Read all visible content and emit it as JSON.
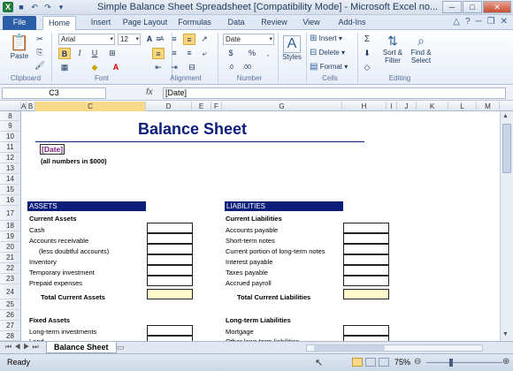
{
  "titlebar": {
    "title": "Simple Balance Sheet Spreadsheet  [Compatibility Mode]  -  Microsoft Excel no...",
    "qat_icons": [
      "excel-logo-icon",
      "save-icon",
      "undo-icon",
      "redo-icon",
      "customize-qat-icon"
    ]
  },
  "tabs": [
    "File",
    "Home",
    "Insert",
    "Page Layout",
    "Formulas",
    "Data",
    "Review",
    "View",
    "Add-Ins"
  ],
  "ribbon": {
    "clipboard": {
      "paste": "Paste",
      "label": "Clipboard"
    },
    "font": {
      "name": "Arial",
      "size": "12",
      "bold": "B",
      "italic": "I",
      "underline": "U",
      "grow": "A",
      "shrink": "A",
      "label": "Font"
    },
    "alignment": {
      "label": "Alignment"
    },
    "number": {
      "format": "Date",
      "currency": "$",
      "percent": "%",
      "comma": ",",
      "inc": ".0",
      "dec": ".00",
      "label": "Number"
    },
    "styles": {
      "styles": "Styles"
    },
    "cells": {
      "insert": "Insert",
      "delete": "Delete",
      "format": "Format",
      "label": "Cells"
    },
    "editing": {
      "sum": "Σ",
      "sort": "Sort &",
      "sort2": "Filter",
      "find": "Find &",
      "find2": "Select",
      "label": "Editing"
    }
  },
  "formula_bar": {
    "namebox": "C3",
    "fx": "fx",
    "content": "[Date]"
  },
  "columns": [
    "A",
    "B",
    "C",
    "D",
    "E",
    "F",
    "G",
    "H",
    "I",
    "J",
    "K",
    "L",
    "M"
  ],
  "rows": [
    "8",
    "9",
    "10",
    "11",
    "12",
    "13",
    "14",
    "15",
    "16",
    "17",
    "18",
    "19",
    "20",
    "21",
    "22",
    "23",
    "24",
    "25",
    "26",
    "27",
    "28"
  ],
  "sheet": {
    "title": "Balance Sheet",
    "date": "[Date]",
    "note": "(all numbers in $000)",
    "assets": {
      "header": "ASSETS",
      "current": "Current Assets",
      "items": [
        "Cash",
        "Accounts receivable",
        "(less doubtful accounts)",
        "Inventory",
        "Temporary investment",
        "Prepaid expenses"
      ],
      "total": "Total Current Assets",
      "fixed": "Fixed Assets",
      "fixed_items": [
        "Long-term investments",
        "Land"
      ]
    },
    "liabilities": {
      "header": "LIABILITIES",
      "current": "Current Liabilities",
      "items": [
        "Accounts payable",
        "Short-term notes",
        "Current portion of long-term notes",
        "Interest payable",
        "Taxes payable",
        "Accrued payroll"
      ],
      "total": "Total Current Liabilities",
      "longterm": "Long-term Liabilities",
      "longterm_items": [
        "Mortgage",
        "Other long-term liabilities"
      ]
    }
  },
  "sheet_tab": "Balance Sheet",
  "status": {
    "ready": "Ready",
    "zoom": "75%"
  },
  "colors": {
    "accent": "#0b1e7a",
    "file_tab": "#2a5ea8",
    "highlight": "#fff9cc",
    "date": "#7a1f7a"
  }
}
